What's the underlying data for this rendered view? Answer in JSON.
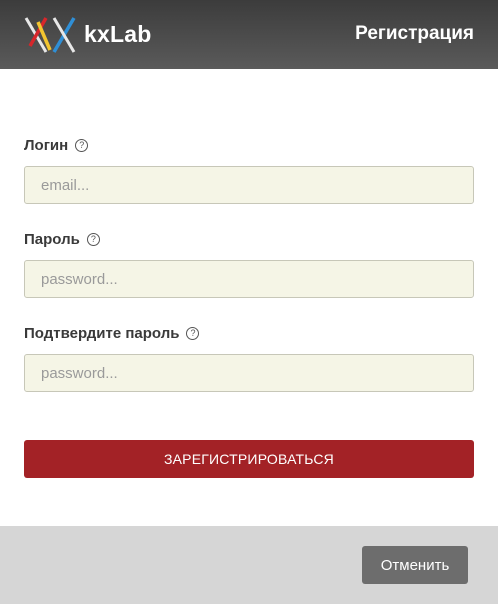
{
  "header": {
    "brand": "kxLab",
    "title": "Регистрация",
    "logo_icon": "kx-logo-icon"
  },
  "form": {
    "login": {
      "label": "Логин",
      "help_icon": "question-circle-icon",
      "help_glyph": "?",
      "placeholder": "email...",
      "value": ""
    },
    "password": {
      "label": "Пароль",
      "help_icon": "question-circle-icon",
      "help_glyph": "?",
      "placeholder": "password...",
      "value": ""
    },
    "confirm_password": {
      "label": "Подтвердите пароль",
      "help_icon": "question-circle-icon",
      "help_glyph": "?",
      "placeholder": "password...",
      "value": ""
    },
    "submit_label": "ЗАРЕГИСТРИРОВАТЬСЯ"
  },
  "footer": {
    "cancel_label": "Отменить"
  },
  "colors": {
    "header": "#4a4a4a",
    "input_bg": "#f5f5e6",
    "submit_bg": "#a32226",
    "footer_bg": "#d6d6d6",
    "cancel_bg": "#6d6d6d"
  }
}
